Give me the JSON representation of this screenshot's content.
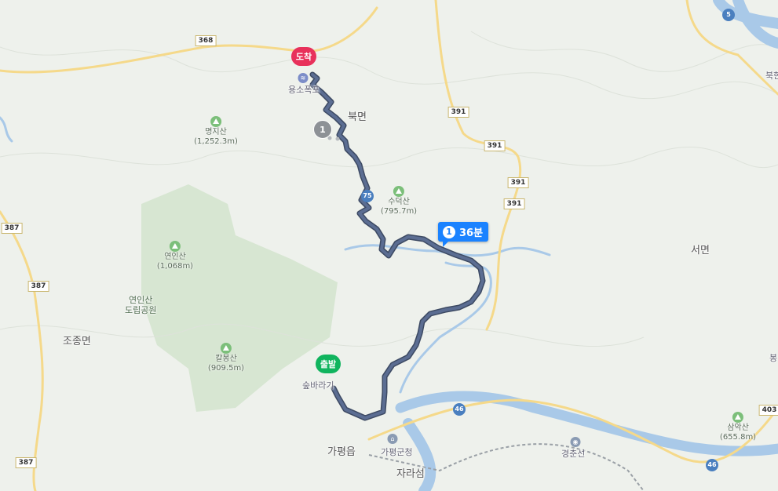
{
  "route": {
    "start_label": "출발",
    "end_label": "도착",
    "time_badge_index": "1",
    "time_badge_text": "36분",
    "waypoint_label": "1",
    "road_marker": "75"
  },
  "places": {
    "start_place": "숲바라기",
    "end_place": "용소폭포",
    "bukmyeon": "북면",
    "seomyeon": "서면",
    "jojongmyeon": "조종면",
    "gapyeongeup": "가평읍",
    "gapyeong_gun": "가평군청",
    "jaraseom": "자라섬",
    "gyeongchun": "경춘선",
    "buk_edge": "북한",
    "bong_edge": "봉",
    "yeonin_park": "연인산\n도립공원"
  },
  "mountains": [
    {
      "name": "명지산",
      "height": "(1,252.3m)"
    },
    {
      "name": "수덕산",
      "height": "(795.7m)"
    },
    {
      "name": "연인산",
      "height": "(1,068m)"
    },
    {
      "name": "칼봉산",
      "height": "(909.5m)"
    },
    {
      "name": "삼악산",
      "height": "(655.8m)"
    }
  ],
  "road_numbers": [
    "368",
    "391",
    "391",
    "391",
    "391",
    "387",
    "387",
    "387",
    "403",
    "46",
    "46",
    "5"
  ],
  "colors": {
    "route": "#4a5a78",
    "start": "#10b45e",
    "end": "#e8315b",
    "badge": "#1a82ff",
    "water": "#a9c9e8",
    "road": "#f5d98a"
  }
}
